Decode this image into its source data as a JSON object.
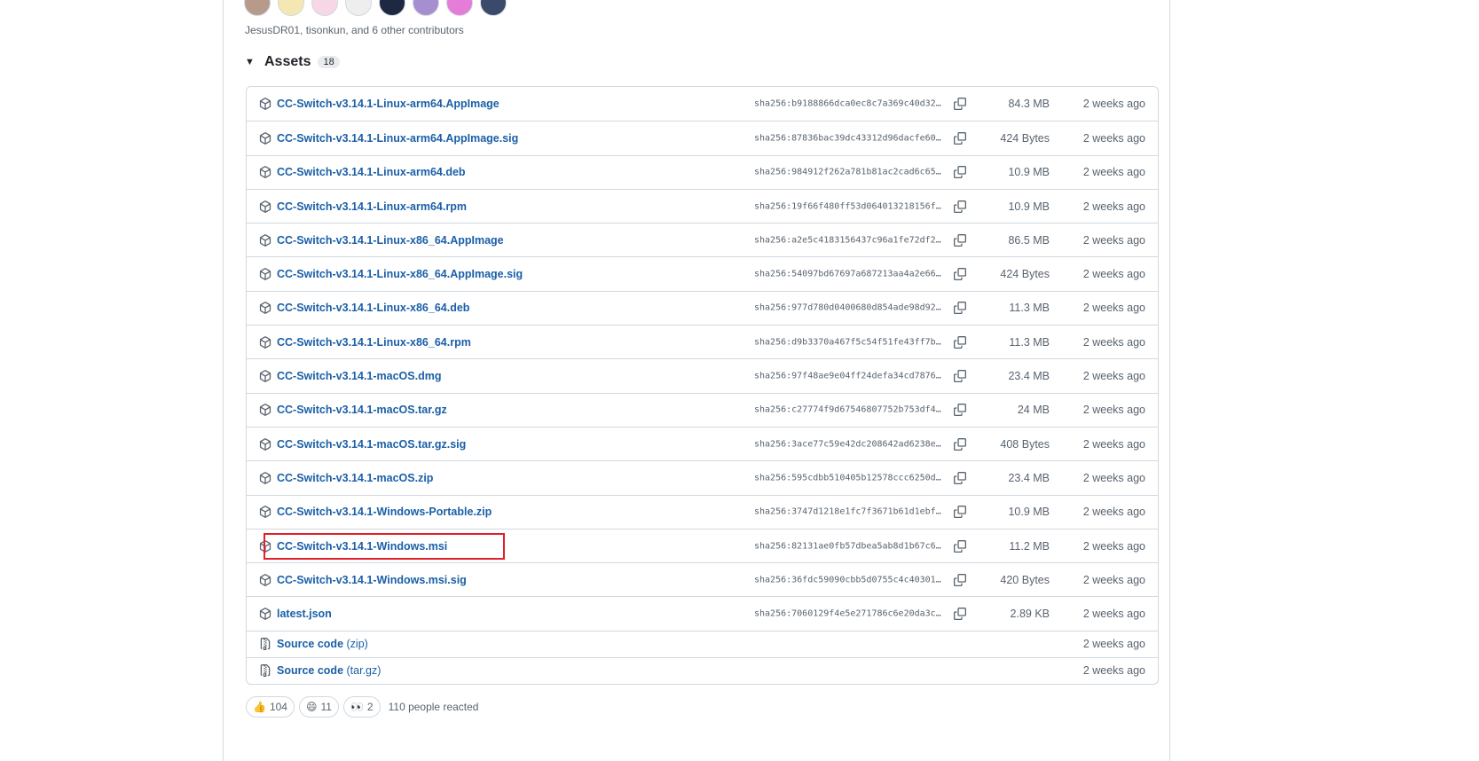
{
  "contributors_text": "JesusDR01, tisonkun, and 6 other contributors",
  "avatars": [
    {
      "name": "avatar-1",
      "color": "#b89a8a"
    },
    {
      "name": "avatar-2",
      "color": "#f4e7b2"
    },
    {
      "name": "avatar-3",
      "color": "#f7d6e6"
    },
    {
      "name": "avatar-4",
      "color": "#eeeeee"
    },
    {
      "name": "avatar-5",
      "color": "#1e2840"
    },
    {
      "name": "avatar-6",
      "color": "#a58fd0"
    },
    {
      "name": "avatar-7",
      "color": "#e47cd8"
    },
    {
      "name": "avatar-8",
      "color": "#3b4a6b"
    }
  ],
  "assets": {
    "title": "Assets",
    "count": "18",
    "rows": [
      {
        "name": "CC-Switch-v3.14.1-Linux-arm64.AppImage",
        "sha": "sha256:b9188866dca0ec8c7a369c40d324f…",
        "size": "84.3 MB",
        "date": "2 weeks ago"
      },
      {
        "name": "CC-Switch-v3.14.1-Linux-arm64.AppImage.sig",
        "sha": "sha256:87836bac39dc43312d96dacfe602d…",
        "size": "424 Bytes",
        "date": "2 weeks ago"
      },
      {
        "name": "CC-Switch-v3.14.1-Linux-arm64.deb",
        "sha": "sha256:984912f262a781b81ac2cad6c6528…",
        "size": "10.9 MB",
        "date": "2 weeks ago"
      },
      {
        "name": "CC-Switch-v3.14.1-Linux-arm64.rpm",
        "sha": "sha256:19f66f480ff53d064013218156f24…",
        "size": "10.9 MB",
        "date": "2 weeks ago"
      },
      {
        "name": "CC-Switch-v3.14.1-Linux-x86_64.AppImage",
        "sha": "sha256:a2e5c4183156437c96a1fe72df2a7…",
        "size": "86.5 MB",
        "date": "2 weeks ago"
      },
      {
        "name": "CC-Switch-v3.14.1-Linux-x86_64.AppImage.sig",
        "sha": "sha256:54097bd67697a687213aa4a2e6661…",
        "size": "424 Bytes",
        "date": "2 weeks ago"
      },
      {
        "name": "CC-Switch-v3.14.1-Linux-x86_64.deb",
        "sha": "sha256:977d780d0400680d854ade98d92fc…",
        "size": "11.3 MB",
        "date": "2 weeks ago"
      },
      {
        "name": "CC-Switch-v3.14.1-Linux-x86_64.rpm",
        "sha": "sha256:d9b3370a467f5c54f51fe43ff7b9a…",
        "size": "11.3 MB",
        "date": "2 weeks ago"
      },
      {
        "name": "CC-Switch-v3.14.1-macOS.dmg",
        "sha": "sha256:97f48ae9e04ff24defa34cd787667…",
        "size": "23.4 MB",
        "date": "2 weeks ago"
      },
      {
        "name": "CC-Switch-v3.14.1-macOS.tar.gz",
        "sha": "sha256:c27774f9d67546807752b753df4c9…",
        "size": "24 MB",
        "date": "2 weeks ago"
      },
      {
        "name": "CC-Switch-v3.14.1-macOS.tar.gz.sig",
        "sha": "sha256:3ace77c59e42dc208642ad6238e31…",
        "size": "408 Bytes",
        "date": "2 weeks ago"
      },
      {
        "name": "CC-Switch-v3.14.1-macOS.zip",
        "sha": "sha256:595cdbb510405b12578ccc6250dd0…",
        "size": "23.4 MB",
        "date": "2 weeks ago"
      },
      {
        "name": "CC-Switch-v3.14.1-Windows-Portable.zip",
        "sha": "sha256:3747d1218e1fc7f3671b61d1ebf05…",
        "size": "10.9 MB",
        "date": "2 weeks ago"
      },
      {
        "name": "CC-Switch-v3.14.1-Windows.msi",
        "sha": "sha256:82131ae0fb57dbea5ab8d1b67c674…",
        "size": "11.2 MB",
        "date": "2 weeks ago"
      },
      {
        "name": "CC-Switch-v3.14.1-Windows.msi.sig",
        "sha": "sha256:36fdc59090cbb5d0755c4c4030108…",
        "size": "420 Bytes",
        "date": "2 weeks ago"
      },
      {
        "name": "latest.json",
        "sha": "sha256:7060129f4e5e271786c6e20da3cda…",
        "size": "2.89 KB",
        "date": "2 weeks ago"
      }
    ],
    "source_rows": [
      {
        "name": "Source code",
        "suffix": "(zip)",
        "date": "2 weeks ago"
      },
      {
        "name": "Source code",
        "suffix": "(tar.gz)",
        "date": "2 weeks ago"
      }
    ]
  },
  "highlight_color": "#e0202a",
  "reactions": {
    "items": [
      {
        "icon": "thumbs-up-icon",
        "emoji": "👍",
        "count": "104"
      },
      {
        "icon": "laugh-icon",
        "emoji": "😄",
        "count": "11"
      },
      {
        "icon": "eyes-icon",
        "emoji": "👀",
        "count": "2"
      }
    ],
    "summary": "110 people reacted"
  }
}
